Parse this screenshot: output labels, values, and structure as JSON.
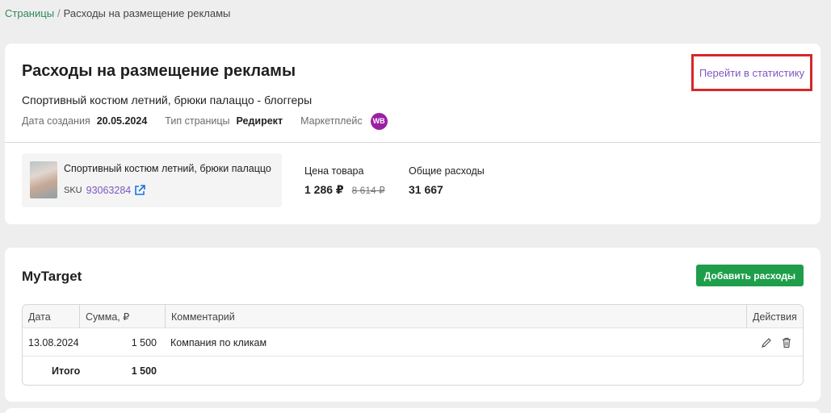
{
  "breadcrumb": {
    "parent": "Страницы",
    "separator": "/",
    "current": "Расходы на размещение рекламы"
  },
  "header": {
    "title": "Расходы на размещение рекламы",
    "stats_link": "Перейти в статистику",
    "subtitle": "Спортивный костюм летний, брюки палаццо - блоггеры",
    "created_label": "Дата создания",
    "created_value": "20.05.2024",
    "page_type_label": "Тип страницы",
    "page_type_value": "Редирект",
    "marketplace_label": "Маркетплейс",
    "marketplace_badge": "WB"
  },
  "product": {
    "name": "Спортивный костюм летний, брюки палаццо",
    "sku_label": "SKU",
    "sku_value": "93063284",
    "price_label": "Цена товара",
    "price_value": "1 286 ₽",
    "old_price": "8 614 ₽",
    "total_label": "Общие расходы",
    "total_value": "31 667"
  },
  "section": {
    "title": "MyTarget",
    "add_button": "Добавить расходы"
  },
  "table": {
    "columns": [
      "Дата",
      "Сумма, ₽",
      "Комментарий",
      "Действия"
    ],
    "rows": [
      {
        "date": "13.08.2024",
        "amount": "1 500",
        "comment": "Компания по кликам"
      }
    ],
    "total_label": "Итого",
    "total_amount": "1 500"
  },
  "colors": {
    "accent_green": "#1e9e4a",
    "link_purple": "#7e57c2",
    "highlight_red": "#d62828",
    "wb_purple": "#9b1fa3"
  }
}
